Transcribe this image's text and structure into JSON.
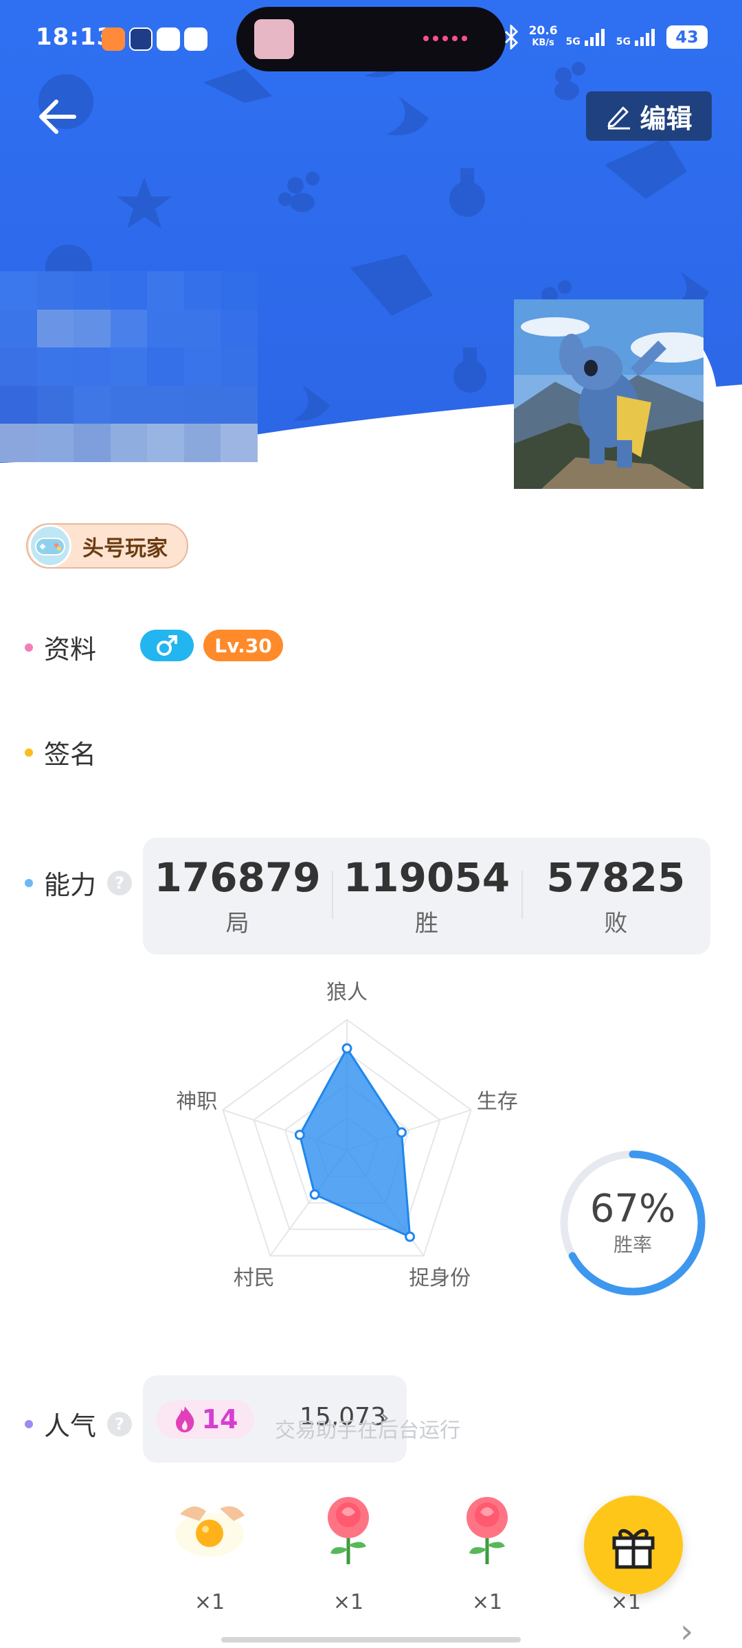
{
  "status_bar": {
    "time": "18:13",
    "net_speed_value": "20.6",
    "net_speed_unit": "KB/s",
    "sim1_label": "5G",
    "sim2_label": "5G",
    "battery": "43",
    "app_icons": [
      "taobao-icon",
      "vpn-icon",
      "app-icon",
      "message-icon"
    ]
  },
  "header": {
    "edit_label": "编辑",
    "background_color": "#2f6ef0",
    "pattern_icons": [
      "wolf-icon",
      "paw-icon",
      "moon-icon",
      "star-icon",
      "potion-icon"
    ]
  },
  "profile": {
    "badge_label": "头号玩家",
    "info_label": "资料",
    "gender": "♂",
    "level": "Lv.30",
    "signature_label": "签名",
    "ability_label": "能力",
    "help_glyph": "?"
  },
  "stats": [
    {
      "value": "176879",
      "label": "局"
    },
    {
      "value": "119054",
      "label": "胜"
    },
    {
      "value": "57825",
      "label": "败"
    }
  ],
  "radar": {
    "axes": [
      "狼人",
      "生存",
      "捉身份",
      "村民",
      "神职"
    ],
    "values": [
      0.78,
      0.44,
      0.82,
      0.42,
      0.38
    ],
    "fill_color": "#2e8ef0"
  },
  "winrate": {
    "value": "67%",
    "label": "胜率",
    "fraction": 0.67,
    "color": "#3d97ee"
  },
  "popularity": {
    "label": "人气",
    "flame_count": "14",
    "count": "15,073",
    "chevron": "›"
  },
  "toast": "交易助手在后台运行",
  "gifts": [
    {
      "icon": "fried-egg-icon",
      "count": "×1"
    },
    {
      "icon": "rose-icon",
      "count": "×1"
    },
    {
      "icon": "rose-icon",
      "count": "×1"
    },
    {
      "icon": "gift-box-icon",
      "count": "×1"
    }
  ],
  "more_chevron": "›"
}
